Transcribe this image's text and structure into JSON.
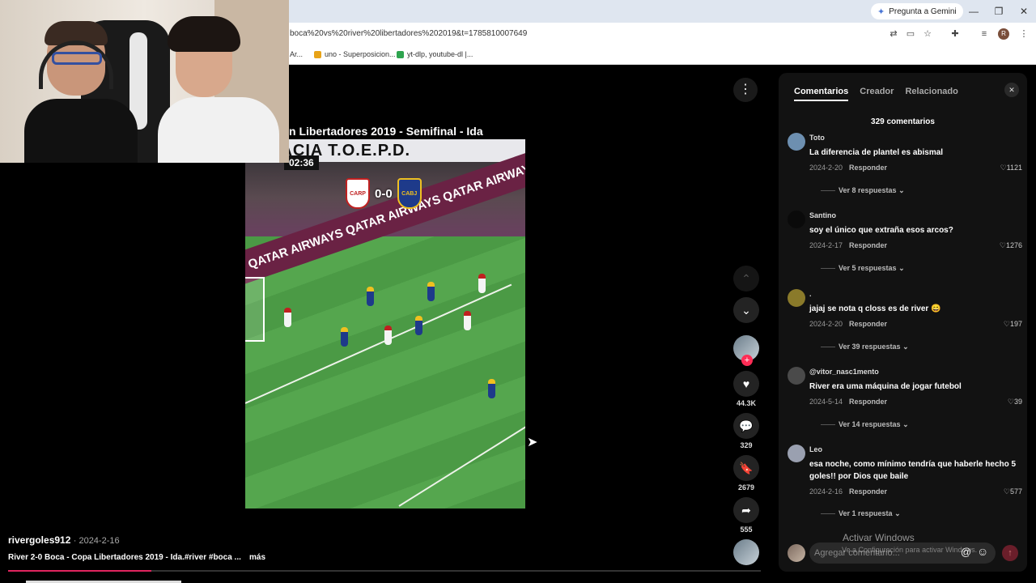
{
  "browser": {
    "gemini_button": "Pregunta a Gemini",
    "url": "boca%20vs%20river%20libertadores%202019&t=1785810007649",
    "bookmarks": [
      {
        "label": "Ar...",
        "color": "#c9c9c9"
      },
      {
        "label": "uno - Superposicion...",
        "color": "#e8a317"
      },
      {
        "label": "yt-dlp, youtube-dl |...",
        "color": "#2ea44f"
      }
    ],
    "profile_initial": "R"
  },
  "video": {
    "title": "n Libertadores 2019 - Semifinal - Ida",
    "banner_text": "RACIA T.O.E.P.D.",
    "adboard_text": "QATAR AIRWAYS   QATAR AIRWAYS   QATAR AIRWAYS",
    "timer": "02:36",
    "score": "0-0",
    "home_crest": "CARP",
    "away_crest": "CABJ",
    "progress_fraction": 0.19
  },
  "info": {
    "author": "rivergoles912",
    "date": "· 2024-2-16",
    "description": "River 2-0 Boca - Copa Libertadores 2019 - Ida.#river #boca ...",
    "more": "más"
  },
  "rail": {
    "menu_icon": "⋮",
    "likes": "44.3K",
    "comments": "329",
    "saves": "2679",
    "shares": "555"
  },
  "panel": {
    "tabs": [
      "Comentarios",
      "Creador",
      "Relacionado"
    ],
    "count": "329 comentarios",
    "comments": [
      {
        "user": "Toto",
        "text": "La diferencia de plantel es abismal",
        "date": "2024-2-20",
        "reply": "Responder",
        "likes": "1121",
        "more": "Ver 8 respuestas",
        "avatar": "#6d8fb0"
      },
      {
        "user": "Santino",
        "text": "soy el único que extraña esos arcos?",
        "date": "2024-2-17",
        "reply": "Responder",
        "likes": "1276",
        "more": "Ver 5 respuestas",
        "avatar": "#0a0a0a"
      },
      {
        "user": ".",
        "text": "jajaj se nota q closs es de river 😄",
        "date": "2024-2-20",
        "reply": "Responder",
        "likes": "197",
        "more": "Ver 39 respuestas",
        "avatar": "#8a7a2a"
      },
      {
        "user": "@vitor_nasc1mento",
        "text": "River era uma máquina de jogar futebol",
        "date": "2024-5-14",
        "reply": "Responder",
        "likes": "39",
        "more": "Ver 14 respuestas",
        "avatar": "#4a4a4a"
      },
      {
        "user": "Leo",
        "text": "esa noche, como mínimo tendría que haberle hecho 5 goles!! por Dios que baile",
        "date": "2024-2-16",
        "reply": "Responder",
        "likes": "577",
        "more": "Ver 1 respuesta",
        "avatar": "#9aa0b0"
      }
    ],
    "input_placeholder": "Agregar comentario..."
  },
  "watermark": {
    "line1": "Activar Windows",
    "line2": "Ve a Configuración para activar Windows."
  }
}
